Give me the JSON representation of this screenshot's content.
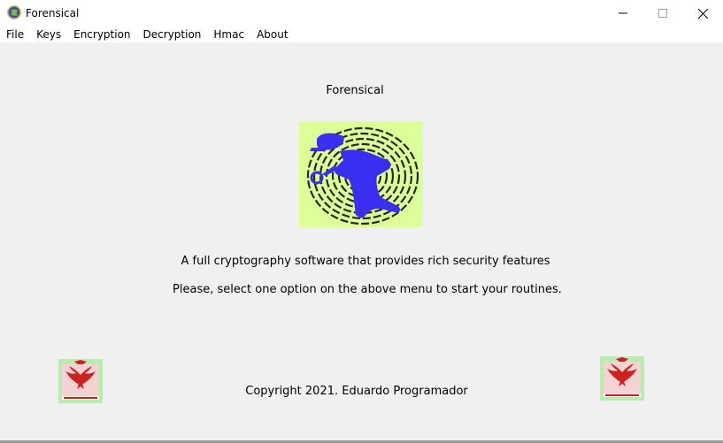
{
  "window": {
    "title": "Forensical"
  },
  "menu": {
    "items": [
      {
        "label": "File"
      },
      {
        "label": "Keys"
      },
      {
        "label": "Encryption"
      },
      {
        "label": "Decryption"
      },
      {
        "label": "Hmac"
      },
      {
        "label": "About"
      }
    ]
  },
  "main": {
    "heading": "Forensical",
    "description": "A full cryptography software that provides rich security features",
    "instruction": "Please, select one option on the above menu to start your routines.",
    "copyright": "Copyright 2021. Eduardo Programador"
  },
  "icons": {
    "app": "globe-shield-icon",
    "logo": "fingerprint-detective-logo",
    "badge": "winged-emblem-badge"
  },
  "colors": {
    "client_background": "#f0f0f0",
    "logo_background": "#ddff99",
    "logo_figure": "#3a2ff0",
    "badge_accent": "#cc2222"
  }
}
